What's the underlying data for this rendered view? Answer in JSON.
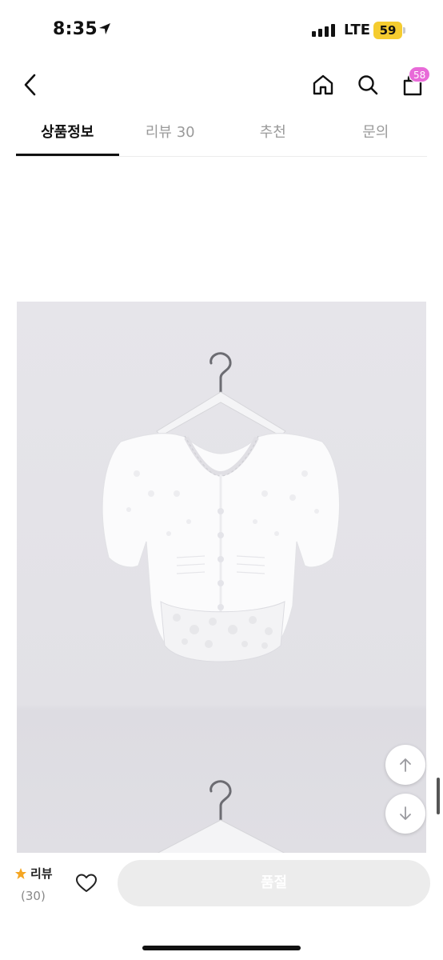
{
  "status_bar": {
    "time": "8:35",
    "network": "LTE",
    "battery": "59"
  },
  "nav": {
    "bag_badge": "58"
  },
  "tabs": [
    {
      "label": "상품정보",
      "active": true
    },
    {
      "label": "리뷰 30",
      "active": false
    },
    {
      "label": "추천",
      "active": false
    },
    {
      "label": "문의",
      "active": false
    }
  ],
  "bottom_bar": {
    "review_label": "리뷰",
    "review_count": "(30)",
    "soldout_label": "품절"
  },
  "colors": {
    "accent_badge": "#e86ad8",
    "star": "#f5a623",
    "battery": "#f5cc2f",
    "image_bg": "#e4e3e8"
  }
}
